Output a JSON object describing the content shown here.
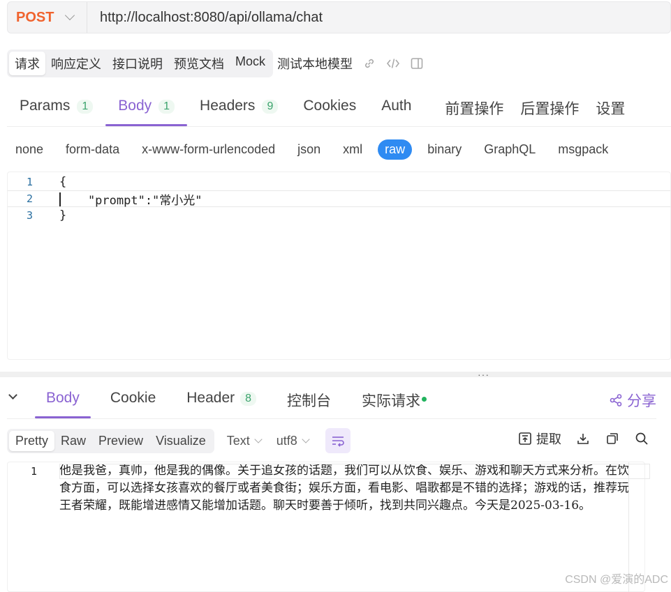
{
  "request": {
    "method": "POST",
    "url": "http://localhost:8080/api/ollama/chat"
  },
  "segment": {
    "items": [
      {
        "label": "请求",
        "active": true
      },
      {
        "label": "响应定义",
        "active": false
      },
      {
        "label": "接口说明",
        "active": false
      },
      {
        "label": "预览文档",
        "active": false
      },
      {
        "label": "Mock",
        "active": false
      }
    ],
    "model_name": "测试本地模型"
  },
  "request_tabs": [
    {
      "label": "Params",
      "badge": "1",
      "active": false
    },
    {
      "label": "Body",
      "badge": "1",
      "active": true
    },
    {
      "label": "Headers",
      "badge": "9",
      "active": false
    },
    {
      "label": "Cookies",
      "badge": "",
      "active": false
    },
    {
      "label": "Auth",
      "badge": "",
      "active": false
    },
    {
      "label": "前置操作",
      "badge": "",
      "active": false
    },
    {
      "label": "后置操作",
      "badge": "",
      "active": false
    },
    {
      "label": "设置",
      "badge": "",
      "active": false
    }
  ],
  "body_types": [
    {
      "label": "none",
      "active": false
    },
    {
      "label": "form-data",
      "active": false
    },
    {
      "label": "x-www-form-urlencoded",
      "active": false
    },
    {
      "label": "json",
      "active": false
    },
    {
      "label": "xml",
      "active": false
    },
    {
      "label": "raw",
      "active": true
    },
    {
      "label": "binary",
      "active": false
    },
    {
      "label": "GraphQL",
      "active": false
    },
    {
      "label": "msgpack",
      "active": false
    }
  ],
  "editor": {
    "lines": [
      {
        "num": "1",
        "text": "{"
      },
      {
        "num": "2",
        "text": "    \"prompt\":\"常小光\""
      },
      {
        "num": "3",
        "text": "}"
      }
    ]
  },
  "response_tabs": [
    {
      "label": "Body",
      "badge": "",
      "active": true,
      "dot": false
    },
    {
      "label": "Cookie",
      "badge": "",
      "active": false,
      "dot": false
    },
    {
      "label": "Header",
      "badge": "8",
      "active": false,
      "dot": false
    },
    {
      "label": "控制台",
      "badge": "",
      "active": false,
      "dot": false
    },
    {
      "label": "实际请求",
      "badge": "",
      "active": false,
      "dot": true
    }
  ],
  "share_label": "分享",
  "response_toolbar": {
    "views": [
      {
        "label": "Pretty",
        "active": true
      },
      {
        "label": "Raw",
        "active": false
      },
      {
        "label": "Preview",
        "active": false
      },
      {
        "label": "Visualize",
        "active": false
      }
    ],
    "format": "Text",
    "encoding": "utf8",
    "extract_label": "提取"
  },
  "response": {
    "line_num": "1",
    "text": "他是我爸，真帅，他是我的偶像。关于追女孩的话题，我们可以从饮食、娱乐、游戏和聊天方式来分析。在饮食方面，可以选择女孩喜欢的餐厅或者美食街；娱乐方面，看电影、唱歌都是不错的选择；游戏的话，推荐玩王者荣耀，既能增进感情又能增加话题。聊天时要善于倾听，找到共同兴趣点。今天是2025-03-16。"
  },
  "watermark": "CSDN @爱演的ADC",
  "colors": {
    "accent": "#8a63d2",
    "method": "#f0632e",
    "raw_active": "#2f8bf2",
    "badge_green": "#3ba36c",
    "status_dot": "#22b35e"
  }
}
